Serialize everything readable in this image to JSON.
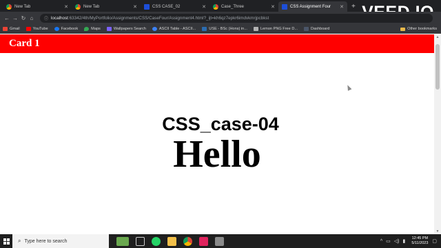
{
  "browser": {
    "tabs": [
      {
        "label": "New Tab",
        "icon": "chrome-icon",
        "active": false
      },
      {
        "label": "New Tab",
        "icon": "chrome-icon",
        "active": false
      },
      {
        "label": "CSS CASE_02",
        "icon": "intellij-icon",
        "active": false
      },
      {
        "label": "Case_Three",
        "icon": "chrome-icon",
        "active": false
      },
      {
        "label": "CSS Assignment Four",
        "icon": "intellij-icon",
        "active": true
      }
    ],
    "url_host": "localhost",
    "url_rest": ":63342/4th/MyPortfolio/Assignments/CSS/CaseFour/Assignment4.html?_ijt=kh6qz7epkr6imdvkmrjpcbkst",
    "bookmarks": [
      {
        "label": "Gmail",
        "color": "#ea4335"
      },
      {
        "label": "YouTube",
        "color": "#ff0000"
      },
      {
        "label": "Facebook",
        "color": "#1877f2"
      },
      {
        "label": "Maps",
        "color": "#34a853"
      },
      {
        "label": "Wallpapers Search",
        "color": "#7b61ff"
      },
      {
        "label": "ASCII Table - ASCII...",
        "color": "#3c82f6"
      },
      {
        "label": "USE - BSc (Hons) in...",
        "color": "#2b6cb0"
      },
      {
        "label": "Lemon PNG Free D...",
        "color": "#b3b3b3"
      },
      {
        "label": "Dashboard",
        "color": "#4a5568"
      }
    ],
    "other_bookmarks": "Other bookmarks"
  },
  "watermark": "VEED.IO",
  "page": {
    "card_title": "Card 1",
    "case_title": "CSS_case-04",
    "hello": "Hello"
  },
  "taskbar": {
    "search_placeholder": "Type here to search",
    "time": "12:45 PM",
    "date": "5/11/2023"
  },
  "colors": {
    "card_header": "#ff0000",
    "chrome_dark": "#35363a"
  }
}
